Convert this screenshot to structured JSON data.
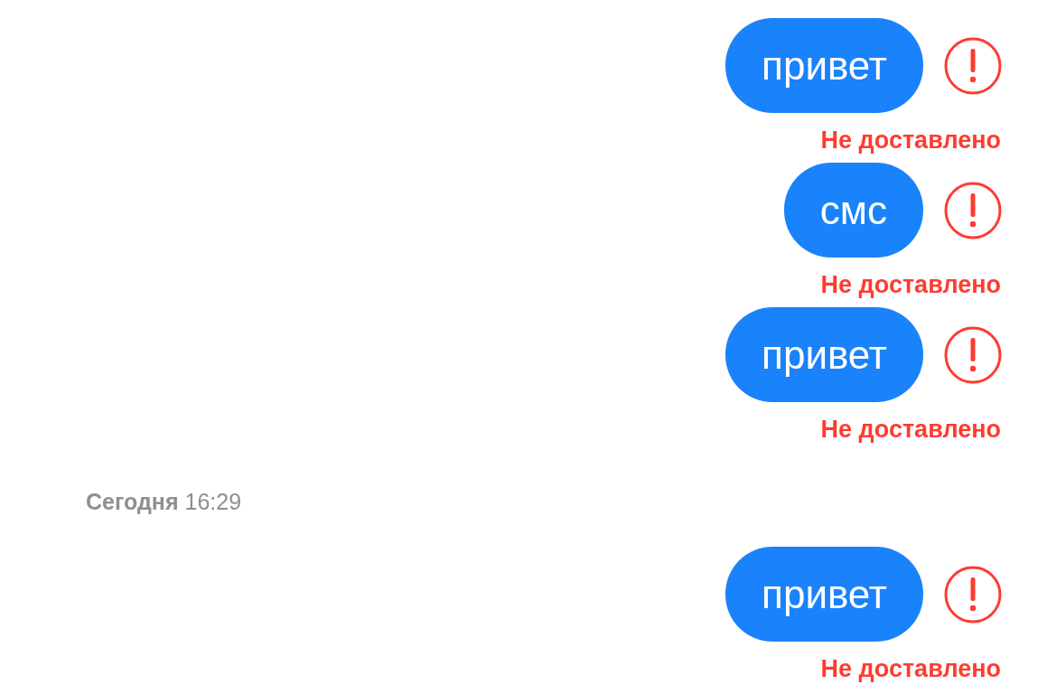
{
  "items": [
    {
      "kind": "message",
      "text": "привет",
      "failed": true,
      "status": "Не доставлено"
    },
    {
      "kind": "message",
      "text": "смс",
      "failed": true,
      "status": "Не доставлено"
    },
    {
      "kind": "message",
      "text": "привет",
      "failed": true,
      "status": "Не доставлено"
    },
    {
      "kind": "timestamp",
      "text": "**Сегодня** 16:29"
    },
    {
      "kind": "message",
      "text": "привет",
      "failed": true,
      "status": "Не доставлено"
    }
  ]
}
